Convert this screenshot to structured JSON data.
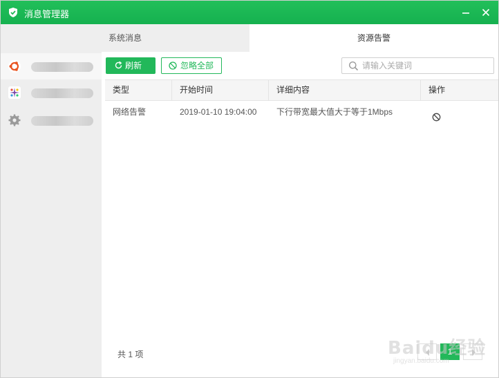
{
  "window": {
    "title": "消息管理器",
    "logo_icon": "shield-check-icon",
    "minimize_icon": "minimize-icon",
    "close_icon": "close-icon",
    "accent": "#22b85a"
  },
  "tabs": [
    {
      "label": "系统消息",
      "active": false
    },
    {
      "label": "资源告警",
      "active": true
    }
  ],
  "sidebar": {
    "items": [
      {
        "icon": "ubuntu-icon",
        "label_blurred": true,
        "selected": true
      },
      {
        "icon": "app-colorful-icon",
        "label_blurred": true,
        "selected": false
      },
      {
        "icon": "gear-icon",
        "label_blurred": true,
        "selected": false
      }
    ]
  },
  "toolbar": {
    "refresh_label": "刷新",
    "refresh_icon": "refresh-icon",
    "ignore_all_label": "忽略全部",
    "ignore_icon": "ban-icon",
    "search_placeholder": "请输入关键词",
    "search_value": "",
    "search_icon": "search-icon"
  },
  "table": {
    "columns": [
      "类型",
      "开始时间",
      "详细内容",
      "操作"
    ],
    "rows": [
      {
        "type": "网络告警",
        "start_time": "2019-01-10 19:04:00",
        "detail": "下行带宽最大值大于等于1Mbps",
        "action_icon": "ban-icon"
      }
    ]
  },
  "footer": {
    "total_text": "共 1 项",
    "current_page": "1"
  },
  "watermark": {
    "line1": "Baidu经验",
    "line2": "jingyan.baidu.com"
  }
}
